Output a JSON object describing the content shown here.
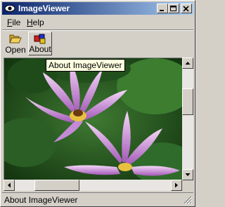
{
  "window": {
    "title": "ImageViewer"
  },
  "menu": {
    "items": [
      {
        "label": "File",
        "accel": "F",
        "rest": "ile"
      },
      {
        "label": "Help",
        "accel": "H",
        "rest": "elp"
      }
    ]
  },
  "toolbar": {
    "open_label": "Open",
    "about_label": "About",
    "active": "about"
  },
  "tooltip": {
    "text": "About ImageViewer"
  },
  "status": {
    "text": "About ImageViewer"
  },
  "image": {
    "subject": "pink water lilies on green lily pads",
    "colors": {
      "petal": "#d48ee0",
      "petal_dark": "#a45ab8",
      "leaf": "#2f6b2a",
      "center": "#e8c040"
    }
  },
  "scrollbars": {
    "vertical_position": 0.3,
    "horizontal_position": 0.2
  },
  "icons": {
    "app": "eye-icon",
    "open": "folder-open-icon",
    "about": "shapes-icon",
    "minimize": "minimize-icon",
    "maximize": "maximize-icon",
    "close": "close-icon"
  }
}
